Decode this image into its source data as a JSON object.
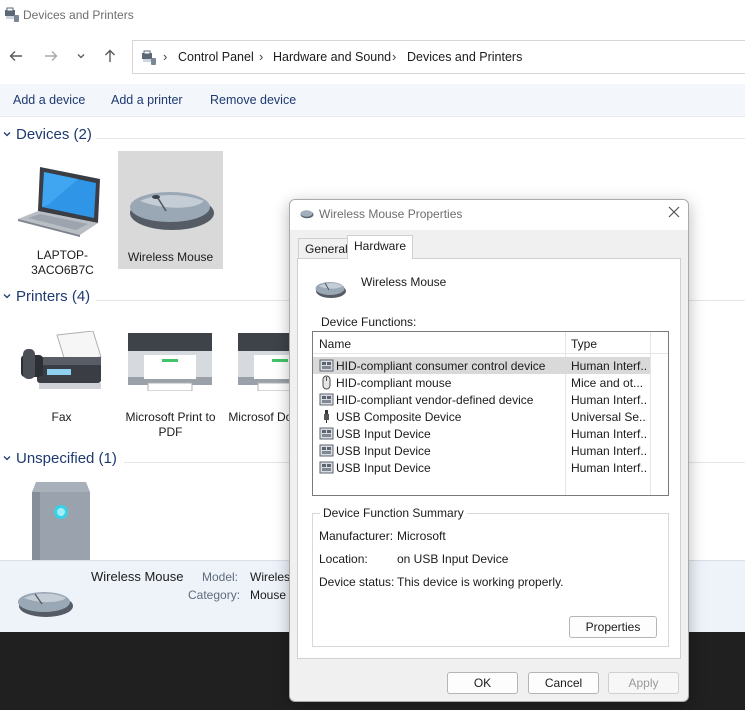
{
  "window": {
    "title": "Devices and Printers"
  },
  "nav": {
    "back_icon": "arrow-left",
    "forward_icon": "arrow-right",
    "recent_icon": "chevron-down",
    "up_icon": "arrow-up"
  },
  "breadcrumb": [
    "Control Panel",
    "Hardware and Sound",
    "Devices and Printers"
  ],
  "commands": [
    "Add a device",
    "Add a printer",
    "Remove device"
  ],
  "groups": {
    "devices": {
      "title": "Devices (2)",
      "items": [
        {
          "label": "LAPTOP-3ACO6B7C",
          "icon": "laptop-icon"
        },
        {
          "label": "Wireless Mouse",
          "icon": "mouse-icon",
          "selected": true
        }
      ]
    },
    "printers": {
      "title": "Printers (4)",
      "items": [
        {
          "label": "Fax",
          "icon": "fax-icon"
        },
        {
          "label": "Microsoft Print to PDF",
          "icon": "printer-icon"
        },
        {
          "label": "Microsof Document",
          "icon": "printer-icon"
        }
      ]
    },
    "unspecified": {
      "title": "Unspecified (1)",
      "items": [
        {
          "label": "",
          "icon": "tower-icon"
        }
      ]
    }
  },
  "details": {
    "name": "Wireless Mouse",
    "model_label": "Model:",
    "model_value": "Wireless",
    "category_label": "Category:",
    "category_value": "Mouse"
  },
  "dialog": {
    "title": "Wireless Mouse Properties",
    "tabs": [
      "General",
      "Hardware"
    ],
    "active_tab": "Hardware",
    "device_name": "Wireless Mouse",
    "functions_label": "Device Functions:",
    "columns": [
      "Name",
      "Type"
    ],
    "functions": [
      {
        "name": "HID-compliant consumer control device",
        "type": "Human Interf...",
        "icon": "hid-icon",
        "selected": true
      },
      {
        "name": "HID-compliant mouse",
        "type": "Mice and ot...",
        "icon": "mouse-small-icon"
      },
      {
        "name": "HID-compliant vendor-defined device",
        "type": "Human Interf...",
        "icon": "hid-icon"
      },
      {
        "name": "USB Composite Device",
        "type": "Universal Se...",
        "icon": "usb-icon"
      },
      {
        "name": "USB Input Device",
        "type": "Human Interf...",
        "icon": "hid-icon"
      },
      {
        "name": "USB Input Device",
        "type": "Human Interf...",
        "icon": "hid-icon"
      },
      {
        "name": "USB Input Device",
        "type": "Human Interf...",
        "icon": "hid-icon"
      }
    ],
    "summary": {
      "legend": "Device Function Summary",
      "manufacturer_label": "Manufacturer:",
      "manufacturer": "Microsoft",
      "location_label": "Location:",
      "location": "on USB Input Device",
      "status_label": "Device status:",
      "status": "This device is working properly."
    },
    "properties_button": "Properties",
    "ok_button": "OK",
    "cancel_button": "Cancel",
    "apply_button": "Apply"
  },
  "colors": {
    "accent": "#1e3a70",
    "selection": "#d9d9d9",
    "details_bg": "#eef3fa",
    "taskbar": "#202020"
  }
}
